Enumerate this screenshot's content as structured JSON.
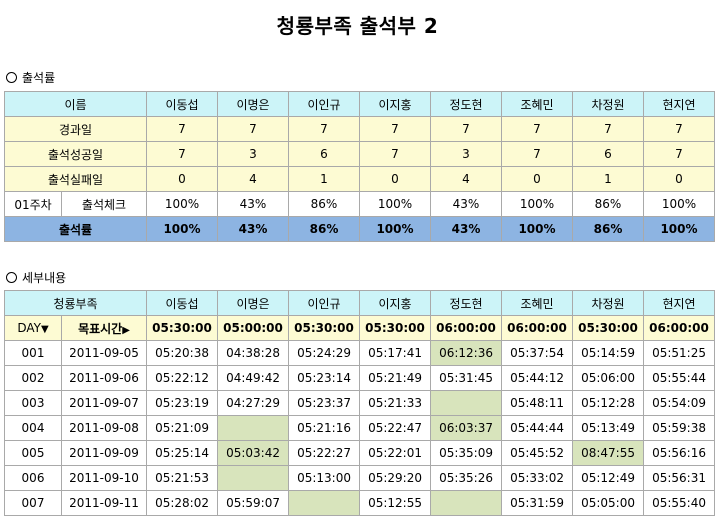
{
  "title": "청룡부족 출석부 2",
  "section1": {
    "label": "출석률"
  },
  "section2": {
    "label": "세부내용"
  },
  "names": [
    "이동섭",
    "이명은",
    "이인규",
    "이지홍",
    "정도현",
    "조혜민",
    "차정원",
    "현지연"
  ],
  "rate": {
    "name_header": "이름",
    "rows": [
      {
        "label": "경과일",
        "values": [
          "7",
          "7",
          "7",
          "7",
          "7",
          "7",
          "7",
          "7"
        ]
      },
      {
        "label": "출석성공일",
        "values": [
          "7",
          "3",
          "6",
          "7",
          "3",
          "7",
          "6",
          "7"
        ]
      },
      {
        "label": "출석실패일",
        "values": [
          "0",
          "4",
          "1",
          "0",
          "4",
          "0",
          "1",
          "0"
        ]
      }
    ],
    "check_row": {
      "week": "01주차",
      "label": "출석체크",
      "values": [
        "100%",
        "43%",
        "86%",
        "100%",
        "43%",
        "100%",
        "86%",
        "100%"
      ]
    },
    "total_row": {
      "label": "출석률",
      "values": [
        "100%",
        "43%",
        "86%",
        "100%",
        "43%",
        "100%",
        "86%",
        "100%"
      ]
    }
  },
  "detail": {
    "header_label": "청룡부족",
    "day_label": "DAY",
    "target_label": "목표시간",
    "targets": [
      "05:30:00",
      "05:00:00",
      "05:30:00",
      "05:30:00",
      "06:00:00",
      "06:00:00",
      "05:30:00",
      "06:00:00"
    ],
    "rows": [
      {
        "day": "001",
        "date": "2011-09-05",
        "times": [
          "05:20:38",
          "04:38:28",
          "05:24:29",
          "05:17:41",
          "06:12:36",
          "05:37:54",
          "05:14:59",
          "05:51:25"
        ],
        "fail": [
          false,
          false,
          false,
          false,
          true,
          false,
          false,
          false
        ]
      },
      {
        "day": "002",
        "date": "2011-09-06",
        "times": [
          "05:22:12",
          "04:49:42",
          "05:23:14",
          "05:21:49",
          "05:31:45",
          "05:44:12",
          "05:06:00",
          "05:55:44"
        ],
        "fail": [
          false,
          false,
          false,
          false,
          false,
          false,
          false,
          false
        ]
      },
      {
        "day": "003",
        "date": "2011-09-07",
        "times": [
          "05:23:19",
          "04:27:29",
          "05:23:37",
          "05:21:33",
          "",
          "05:48:11",
          "05:12:28",
          "05:54:09"
        ],
        "fail": [
          false,
          false,
          false,
          false,
          true,
          false,
          false,
          false
        ]
      },
      {
        "day": "004",
        "date": "2011-09-08",
        "times": [
          "05:21:09",
          "",
          "05:21:16",
          "05:22:47",
          "06:03:37",
          "05:44:44",
          "05:13:49",
          "05:59:38"
        ],
        "fail": [
          false,
          true,
          false,
          false,
          true,
          false,
          false,
          false
        ]
      },
      {
        "day": "005",
        "date": "2011-09-09",
        "times": [
          "05:25:14",
          "05:03:42",
          "05:22:27",
          "05:22:01",
          "05:35:09",
          "05:45:52",
          "08:47:55",
          "05:56:16"
        ],
        "fail": [
          false,
          true,
          false,
          false,
          false,
          false,
          true,
          false
        ]
      },
      {
        "day": "006",
        "date": "2011-09-10",
        "times": [
          "05:21:53",
          "",
          "05:13:00",
          "05:29:20",
          "05:35:26",
          "05:33:02",
          "05:12:49",
          "05:56:31"
        ],
        "fail": [
          false,
          true,
          false,
          false,
          false,
          false,
          false,
          false
        ]
      },
      {
        "day": "007",
        "date": "2011-09-11",
        "times": [
          "05:28:02",
          "05:59:07",
          "",
          "05:12:55",
          "",
          "05:31:59",
          "05:05:00",
          "05:55:40"
        ],
        "fail": [
          false,
          false,
          true,
          false,
          true,
          false,
          false,
          false
        ]
      }
    ]
  },
  "colors": {
    "header_bg": "#ccf4f8",
    "yellow_bg": "#fdfbd3",
    "total_bg": "#8db4e2",
    "fail_bg": "#d8e4bc"
  }
}
